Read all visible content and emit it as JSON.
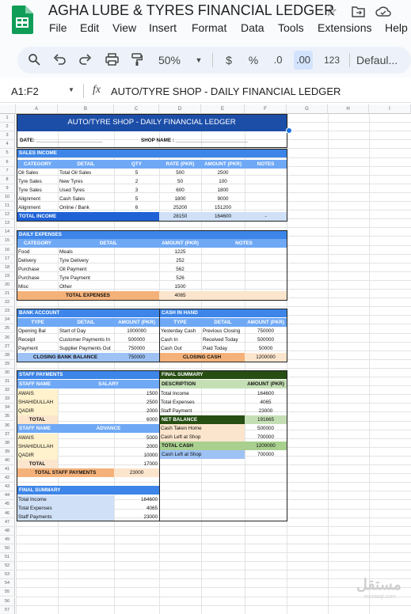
{
  "app": {
    "title": "AGHA LUBE & TYRES FINANCIAL LEDGER",
    "menu": [
      "File",
      "Edit",
      "View",
      "Insert",
      "Format",
      "Data",
      "Tools",
      "Extensions",
      "Help"
    ],
    "zoom": "50%",
    "currency": "$",
    "percent": "%",
    "dec_less": ".0",
    "dec_more": ".00",
    "num_format": "123",
    "font": "Defaul...",
    "cell_ref": "A1:F2",
    "formula": "AUTO/TYRE SHOP - DAILY FINANCIAL LEDGER"
  },
  "columns": [
    "A",
    "B",
    "C",
    "D",
    "E",
    "F",
    "G",
    "H",
    "I"
  ],
  "rows": [
    "1",
    "2",
    "3",
    "4",
    "5",
    "6",
    "7",
    "8",
    "9",
    "10",
    "11",
    "12",
    "13",
    "14",
    "15",
    "16",
    "17",
    "18",
    "19",
    "20",
    "21",
    "22",
    "23",
    "24",
    "25",
    "26",
    "27",
    "28",
    "29",
    "30",
    "31",
    "32",
    "33",
    "34",
    "35",
    "36",
    "37",
    "38",
    "39",
    "40",
    "41",
    "42",
    "43",
    "44",
    "45",
    "46",
    "47",
    "48",
    "49",
    "50",
    "51",
    "52",
    "53",
    "54",
    "55",
    "56",
    "57",
    "58",
    "59"
  ],
  "sheet": {
    "title": "AUTO/TYRE SHOP - DAILY FINANCIAL LEDGER",
    "date_label": "DATE: ________________________",
    "shop_label": "SHOP NAME : __________________________",
    "sales": {
      "title": "SALES INCOME",
      "headers": [
        "CATEGORY",
        "DETAIL",
        "QTY",
        "RATE (PKR)",
        "AMOUNT (PKR)",
        "NOTES"
      ],
      "rows": [
        [
          "Oil Sales",
          "Total Oil Sales",
          "5",
          "500",
          "2500"
        ],
        [
          "Tyre Sales",
          "New Tyres",
          "2",
          "50",
          "100"
        ],
        [
          "Tyre Sales",
          "Used Tyres",
          "3",
          "600",
          "1800"
        ],
        [
          "Alignment",
          "Cash Sales",
          "5",
          "1800",
          "9000"
        ],
        [
          "Alignment",
          "Online / Bank",
          "6",
          "25200",
          "151200"
        ]
      ],
      "total_label": "TOTAL INCOME",
      "total_rate": "28150",
      "total_amount": "164600",
      "total_notes": "-"
    },
    "expenses": {
      "title": "DAILY EXPENSES",
      "headers": [
        "CATEGORY",
        "DETAIL",
        "AMOUNT (PKR)",
        "NOTES"
      ],
      "rows": [
        [
          "Food",
          "Meals",
          "1225"
        ],
        [
          "Delivery",
          "Tyre Delivery",
          "252"
        ],
        [
          "Purchase",
          "Oil Payment",
          "562"
        ],
        [
          "Purchase",
          "Tyre Payment",
          "526"
        ],
        [
          "Misc",
          "Other",
          "1500"
        ]
      ],
      "total_label": "TOTAL EXPENSES",
      "total": "4065"
    },
    "bank": {
      "title": "BANK ACCOUNT",
      "headers": [
        "TYPE",
        "DETAIL",
        "AMOUNT (PKR)"
      ],
      "rows": [
        [
          "Opening Bal",
          "Start of Day",
          "1000000"
        ],
        [
          "Receipt",
          "Customer Payments In",
          "500000"
        ],
        [
          "Payment",
          "Supplier Payments Out",
          "750000"
        ]
      ],
      "closing_label": "CLOSING BANK BALANCE",
      "closing": "750000"
    },
    "cash": {
      "title": "CASH IN HAND",
      "headers": [
        "TYPE",
        "DETAIL",
        "AMOUNT (PKR)"
      ],
      "rows": [
        [
          "Yesterday Cash",
          "Previous Closing",
          "750000"
        ],
        [
          "Cash In",
          "Received Today",
          "500000"
        ],
        [
          "Cash Out",
          "Paid Today",
          "50000"
        ]
      ],
      "closing_label": "CLOSING CASH",
      "closing": "1200000"
    },
    "staff": {
      "title": "STAFF PAYMENTS",
      "h1": "STAFF NAME",
      "h2": "SALARY",
      "salary": [
        [
          "AWAIS",
          "1500"
        ],
        [
          "SHAHIDULLAH",
          "2500"
        ],
        [
          "QADIR",
          "2000"
        ]
      ],
      "total_label": "TOTAL",
      "total_salary": "6000",
      "h3": "STAFF NAME",
      "h4": "ADVANCE",
      "advance": [
        [
          "AWAIS",
          "5000"
        ],
        [
          "SHAHIDULLAH",
          "2000"
        ],
        [
          "QADIR",
          "10000"
        ]
      ],
      "total_advance": "17000",
      "grand_label": "TOTAL STAFF PAYMENTS",
      "grand_total": "23000"
    },
    "final": {
      "title": "FINAL SUMMARY",
      "h1": "DESCRIPTION",
      "h2": "AMOUNT (PKR)",
      "rows": [
        [
          "Total Income",
          "164600"
        ],
        [
          "Total Expenses",
          "4065"
        ],
        [
          "Staff Payment",
          "23000"
        ]
      ],
      "net_label": "NET BALANCE",
      "net": "191665",
      "rows2": [
        [
          "Cash Taken Home",
          "500000"
        ],
        [
          "Cash Left at Shop",
          "700000"
        ]
      ],
      "total_cash_label": "TOTAL CASH",
      "total_cash": "1200000",
      "left_label": "Cash Left at Shop",
      "left": "700000"
    },
    "final2": {
      "title": "FINAL SUMMARY",
      "rows": [
        [
          "Total Income",
          "164600"
        ],
        [
          "Total Expenses",
          "4065"
        ],
        [
          "Staff Payments",
          "23000"
        ]
      ]
    }
  },
  "watermark": "مستقل"
}
